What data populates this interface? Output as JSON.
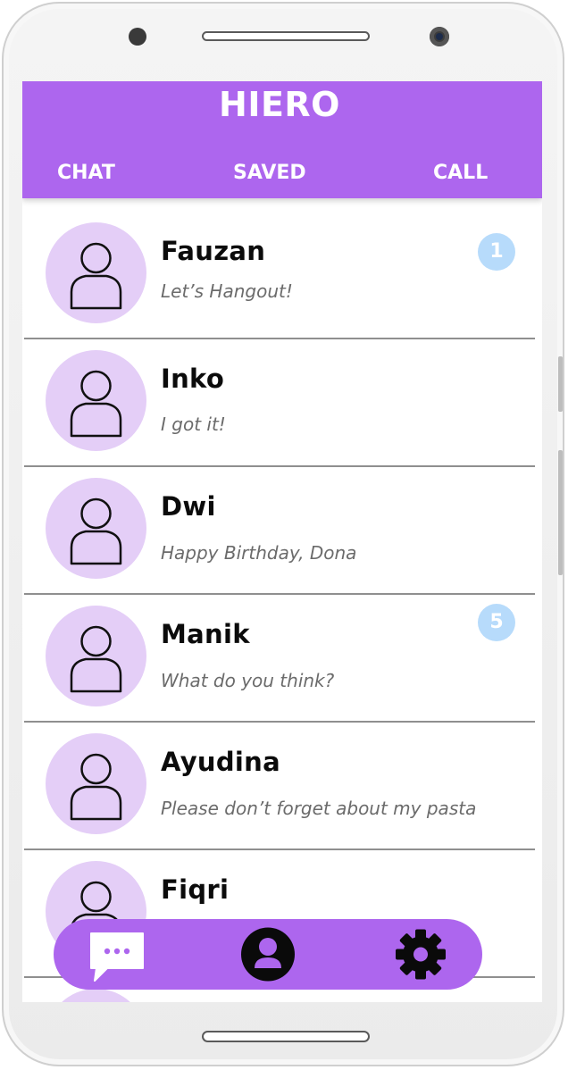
{
  "app": {
    "title": "HIERO",
    "accent_color": "#ad66ee",
    "avatar_color": "#e4cef7",
    "badge_color": "#b7dbfb"
  },
  "tabs": [
    {
      "label": "CHAT"
    },
    {
      "label": "SAVED"
    },
    {
      "label": "CALL"
    }
  ],
  "chats": [
    {
      "name": "Fauzan",
      "message": "Let’s Hangout!",
      "unread": "1",
      "avatar_icon": "person-outline-icon"
    },
    {
      "name": "Inko",
      "message": "I got it!",
      "unread": null,
      "avatar_icon": "person-outline-icon"
    },
    {
      "name": "Dwi",
      "message": "Happy Birthday, Dona",
      "unread": null,
      "avatar_icon": "person-outline-icon"
    },
    {
      "name": "Manik",
      "message": "What do you think?",
      "unread": "5",
      "avatar_icon": "person-outline-icon"
    },
    {
      "name": "Ayudina",
      "message": "Please don’t forget about my pasta",
      "unread": null,
      "avatar_icon": "person-outline-icon"
    },
    {
      "name": "Fiqri",
      "message": "",
      "unread": null,
      "avatar_icon": "person-outline-icon"
    }
  ],
  "bottom_nav": {
    "items": [
      {
        "icon": "chat-bubble-icon"
      },
      {
        "icon": "profile-icon"
      },
      {
        "icon": "gear-icon"
      }
    ]
  }
}
